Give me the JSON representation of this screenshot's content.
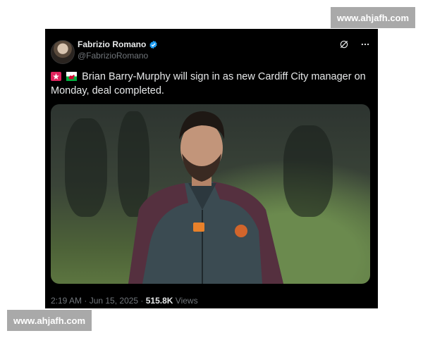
{
  "watermark": {
    "text": "www.ahjafh.com"
  },
  "tweet": {
    "author_name": "Fabrizio Romano",
    "handle": "@FabrizioRomano",
    "text": "Brian Barry-Murphy will sign in as new Cardiff City manager on Monday, deal completed.",
    "flags": [
      "siren-icon",
      "wales-flag-icon"
    ],
    "timestamp": "2:19 AM · Jun 15, 2025 · ",
    "views_count": "515.8K",
    "views_label": " Views",
    "verified_color": "#1d9bf0"
  },
  "icons": [
    "grok-icon",
    "more-icon",
    "verified-icon"
  ]
}
